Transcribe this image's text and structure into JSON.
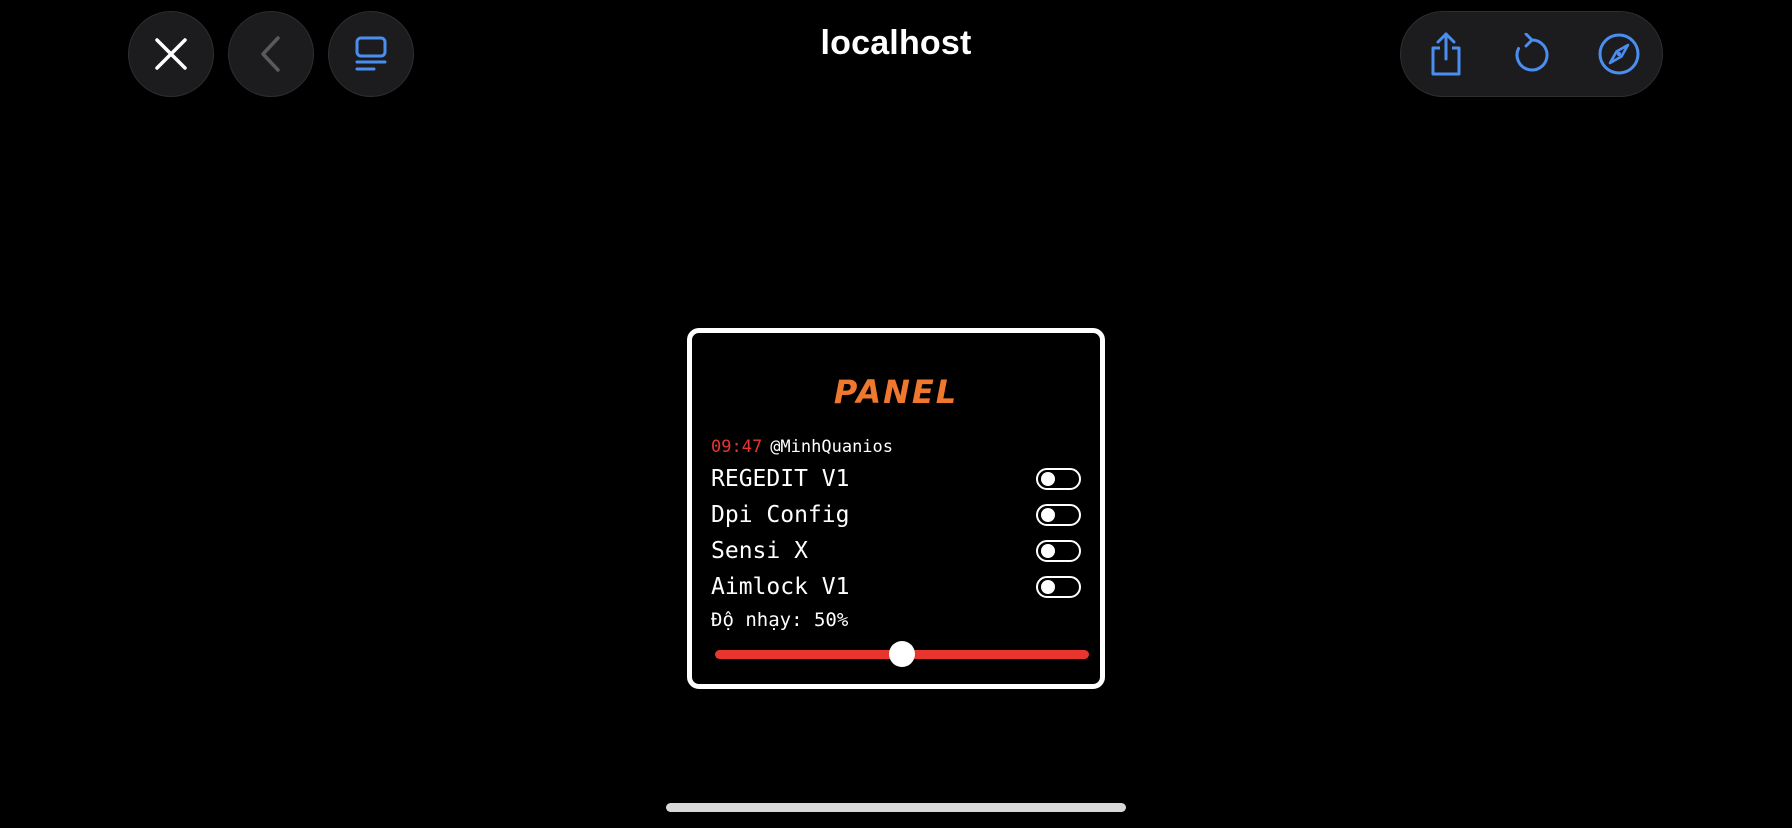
{
  "browser": {
    "title": "localhost",
    "accent_color": "#4a8ef0",
    "left_buttons": [
      {
        "icon": "close-icon"
      },
      {
        "icon": "back-chevron-icon"
      },
      {
        "icon": "tabs-icon"
      }
    ],
    "right_buttons": [
      {
        "icon": "share-icon"
      },
      {
        "icon": "reload-icon"
      },
      {
        "icon": "compass-icon"
      }
    ]
  },
  "panel": {
    "title": "PANEL",
    "title_color": "#f0782e",
    "time": "09:47",
    "user": "@MinhQuanios",
    "options": [
      {
        "label": "REGEDIT V1",
        "enabled": false
      },
      {
        "label": "Dpi Config",
        "enabled": false
      },
      {
        "label": "Sensi X",
        "enabled": false
      },
      {
        "label": "Aimlock V1",
        "enabled": false
      }
    ],
    "slider": {
      "label": "Độ nhạy: 50%",
      "value_percent": 50,
      "track_color": "#e8362f"
    }
  }
}
